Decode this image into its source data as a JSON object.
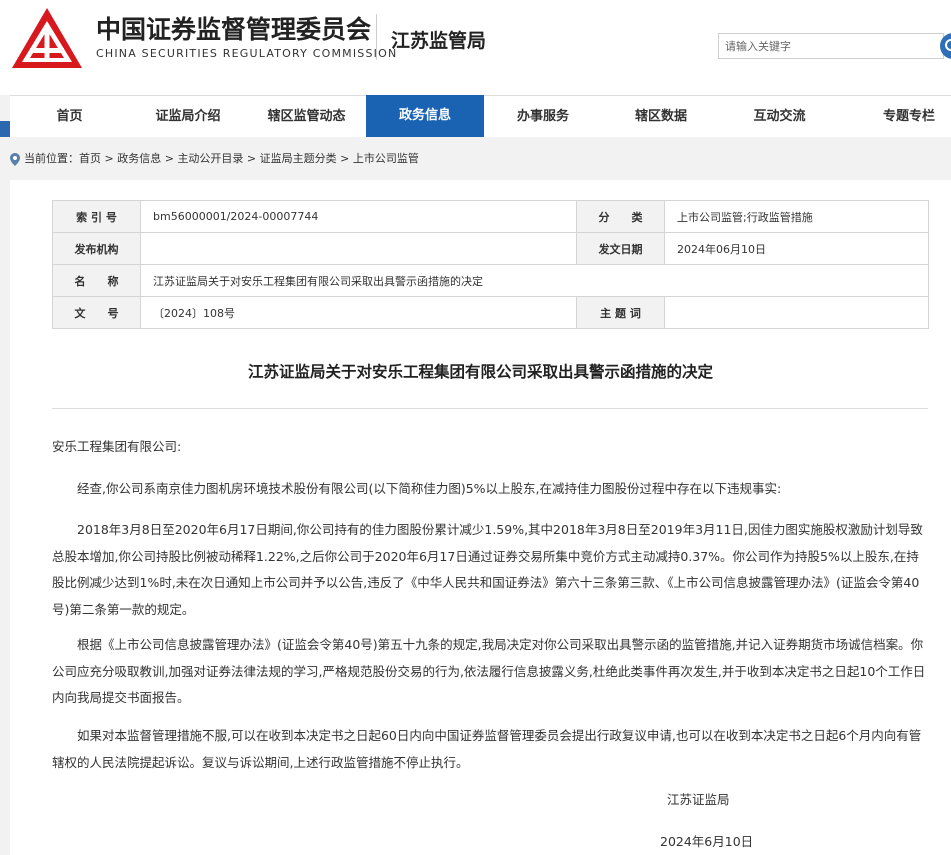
{
  "header": {
    "org_name_cn": "中国证券监督管理委员会",
    "org_name_en": "CHINA SECURITIES REGULATORY COMMISSION",
    "bureau": "江苏监管局",
    "search_placeholder": "请输入关键字",
    "logo_icon": "csrc-logo-icon",
    "search_icon": "search-icon",
    "brand_color": "#d7191e",
    "accent_color": "#1a63b3"
  },
  "nav": {
    "items": [
      {
        "label": "首页",
        "active": false
      },
      {
        "label": "证监局介绍",
        "active": false
      },
      {
        "label": "辖区监管动态",
        "active": false
      },
      {
        "label": "政务信息",
        "active": true
      },
      {
        "label": "办事服务",
        "active": false
      },
      {
        "label": "辖区数据",
        "active": false
      },
      {
        "label": "互动交流",
        "active": false
      },
      {
        "label": "专题专栏",
        "active": false
      }
    ]
  },
  "breadcrumb": {
    "prefix": "当前位置：",
    "items": [
      "首页",
      "政务信息",
      "主动公开目录",
      "证监局主题分类",
      "上市公司监管"
    ],
    "separator": " > "
  },
  "meta": {
    "index_label": "索 引 号",
    "index_value": "bm56000001/2024-00007744",
    "category_label": "分　　类",
    "category_value": "上市公司监管;行政监管措施",
    "publisher_label": "发布机构",
    "publisher_value": "",
    "date_label": "发文日期",
    "date_value": "2024年06月10日",
    "name_label": "名　　称",
    "name_value": "江苏证监局关于对安乐工程集团有限公司采取出具警示函措施的决定",
    "docno_label": "文　　号",
    "docno_value": "〔2024〕108号",
    "keywords_label": "主 题 词",
    "keywords_value": ""
  },
  "document": {
    "title": "江苏证监局关于对安乐工程集团有限公司采取出具警示函措施的决定",
    "salutation": "安乐工程集团有限公司:",
    "paragraphs": [
      "经查,你公司系南京佳力图机房环境技术股份有限公司(以下简称佳力图)5%以上股东,在减持佳力图股份过程中存在以下违规事实:",
      "2018年3月8日至2020年6月17日期间,你公司持有的佳力图股份累计减少1.59%,其中2018年3月8日至2019年3月11日,因佳力图实施股权激励计划导致总股本增加,你公司持股比例被动稀释1.22%,之后你公司于2020年6月17日通过证券交易所集中竞价方式主动减持0.37%。你公司作为持股5%以上股东,在持股比例减少达到1%时,未在次日通知上市公司并予以公告,违反了《中华人民共和国证券法》第六十三条第三款、《上市公司信息披露管理办法》(证监会令第40号)第二条第一款的规定。",
      "根据《上市公司信息披露管理办法》(证监会令第40号)第五十九条的规定,我局决定对你公司采取出具警示函的监管措施,并记入证券期货市场诚信档案。你公司应充分吸取教训,加强对证券法律法规的学习,严格规范股份交易的行为,依法履行信息披露义务,杜绝此类事件再次发生,并于收到本决定书之日起10个工作日内向我局提交书面报告。",
      "如果对本监督管理措施不服,可以在收到本决定书之日起60日内向中国证券监督管理委员会提出行政复议申请,也可以在收到本决定书之日起6个月内向有管辖权的人民法院提起诉讼。复议与诉讼期间,上述行政监管措施不停止执行。"
    ],
    "signature": "江苏证监局",
    "date": "2024年6月10日"
  }
}
